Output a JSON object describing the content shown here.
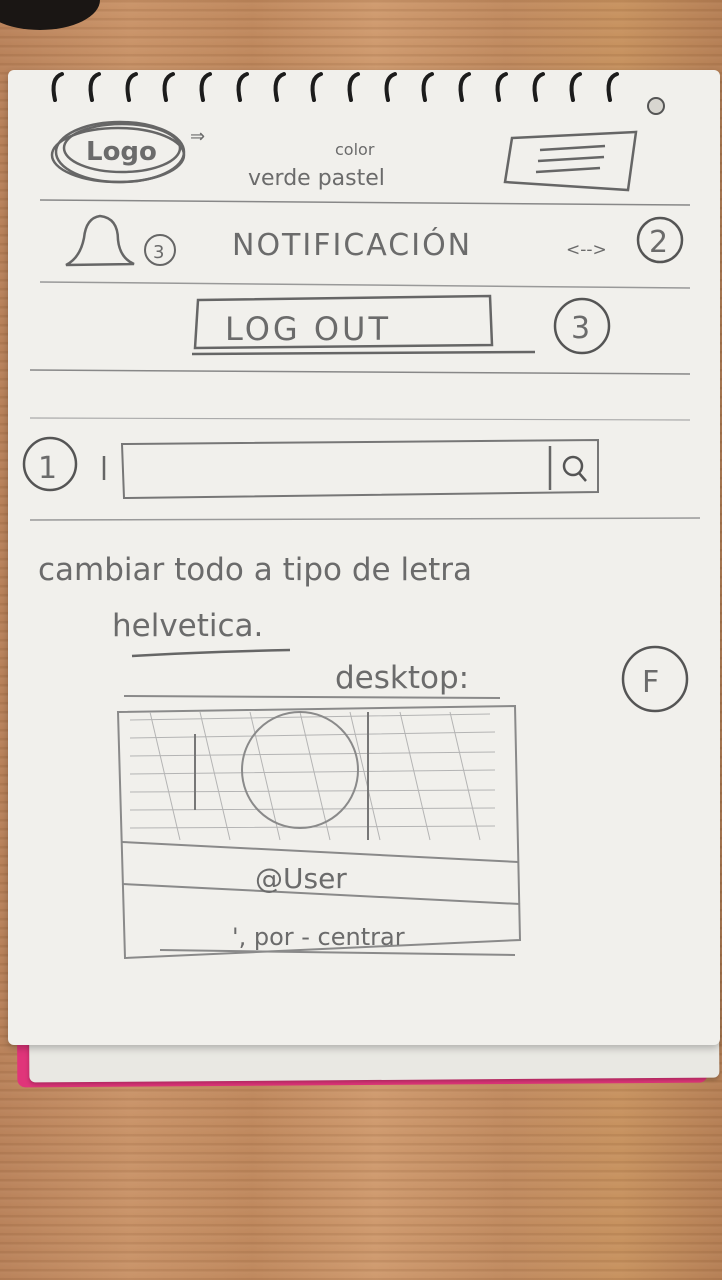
{
  "sketch": {
    "logo_label": "Logo",
    "color_note": "color",
    "color_value": "verde pastel",
    "notification_badge": "3",
    "notification_label": "NOTIFICACIÓN",
    "notification_arrows": "<-->",
    "notification_step": "2",
    "logout_label": "LOG OUT",
    "logout_step": "3",
    "search_step": "1",
    "font_note": "cambiar todo a tipo de letra",
    "font_value": "helvetica.",
    "desktop_label": "desktop:",
    "desktop_step": "F",
    "username": "@User",
    "center_note": "', por - centrar"
  }
}
